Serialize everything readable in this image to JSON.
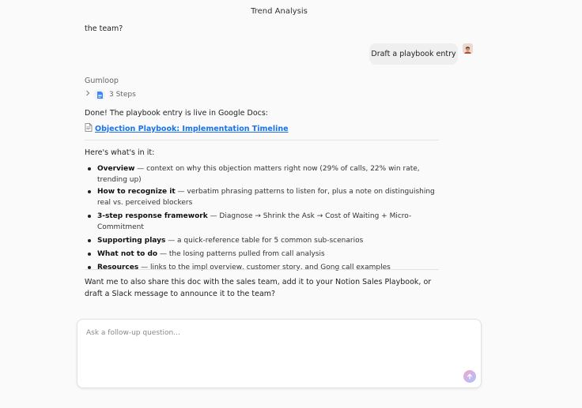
{
  "header": {
    "title": "Trend Analysis"
  },
  "conversation": {
    "previous_text": "the team?",
    "user_message": "Draft a playbook entry",
    "assistant_name": "Gumloop",
    "steps_label": "3 Steps",
    "done_text": "Done! The playbook entry is live in Google Docs:",
    "doc_link": "Objection Playbook: Implementation Timeline",
    "intro": "Here's what's in it:",
    "bullets": [
      {
        "title": "Overview",
        "text": " — context on why this objection matters right now (29% of calls, 22% win rate, trending up)"
      },
      {
        "title": "How to recognize it",
        "text": " — verbatim phrasing patterns to listen for, plus a note on distinguishing real vs. perceived blockers"
      },
      {
        "title": "3-step response framework",
        "text": " — Diagnose → Shrink the Ask → Cost of Waiting + Micro-Commitment"
      },
      {
        "title": "Supporting plays",
        "text": " — a quick-reference table for 5 common sub-scenarios"
      },
      {
        "title": "What not to do",
        "text": " — the losing patterns pulled from call analysis"
      },
      {
        "title": "Resources",
        "text": " — links to the impl overview, customer story, and Gong call examples"
      }
    ],
    "closing": "Want me to also share this doc with the sales team, add it to your Notion Sales Playbook, or draft a Slack message to announce it to the team?"
  },
  "composer": {
    "placeholder": "Ask a follow-up question...",
    "value": ""
  },
  "colors": {
    "link": "#1a73e8",
    "bubble": "#efefef"
  }
}
